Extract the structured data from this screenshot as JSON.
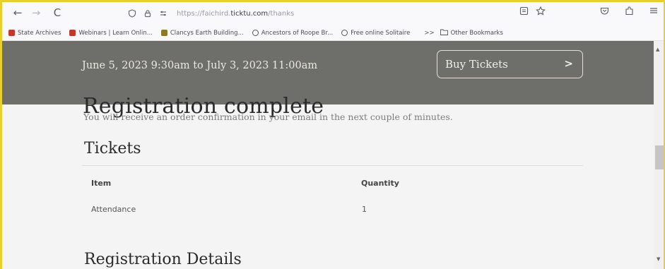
{
  "browser": {
    "url_prefix": "https://faichird.",
    "url_domain": "ticktu.com",
    "url_path": "/thanks",
    "back_icon": "←",
    "forward_icon": "→",
    "reload_icon": "C",
    "bookmarks": [
      {
        "label": "State Archives",
        "color": "#c0392b"
      },
      {
        "label": "Webinars | Learn Onlin...",
        "color": "#c0392b"
      },
      {
        "label": "Clancys Earth Building...",
        "color": "#8a7a2a"
      },
      {
        "label": "Ancestors of Roope Br...",
        "color": "#555555"
      },
      {
        "label": "Free online Solitaire",
        "color": "#555555"
      }
    ],
    "more_bookmarks": ">>",
    "other_bookmarks": "Other Bookmarks"
  },
  "banner": {
    "date_range": "June 5, 2023 9:30am to July 3, 2023 11:00am",
    "buy_label": "Buy Tickets",
    "buy_arrow": ">"
  },
  "content": {
    "title": "Registration complete",
    "confirmation": "You will receive an order confirmation in your email in the next couple of minutes.",
    "tickets_heading": "Tickets",
    "table_headers": {
      "item": "Item",
      "quantity": "Quantity"
    },
    "rows": [
      {
        "item": "Attendance",
        "quantity": "1"
      }
    ],
    "details_heading": "Registration Details"
  },
  "colors": {
    "banner": "#6e6e6b",
    "highlight": "#e8cf2c"
  }
}
